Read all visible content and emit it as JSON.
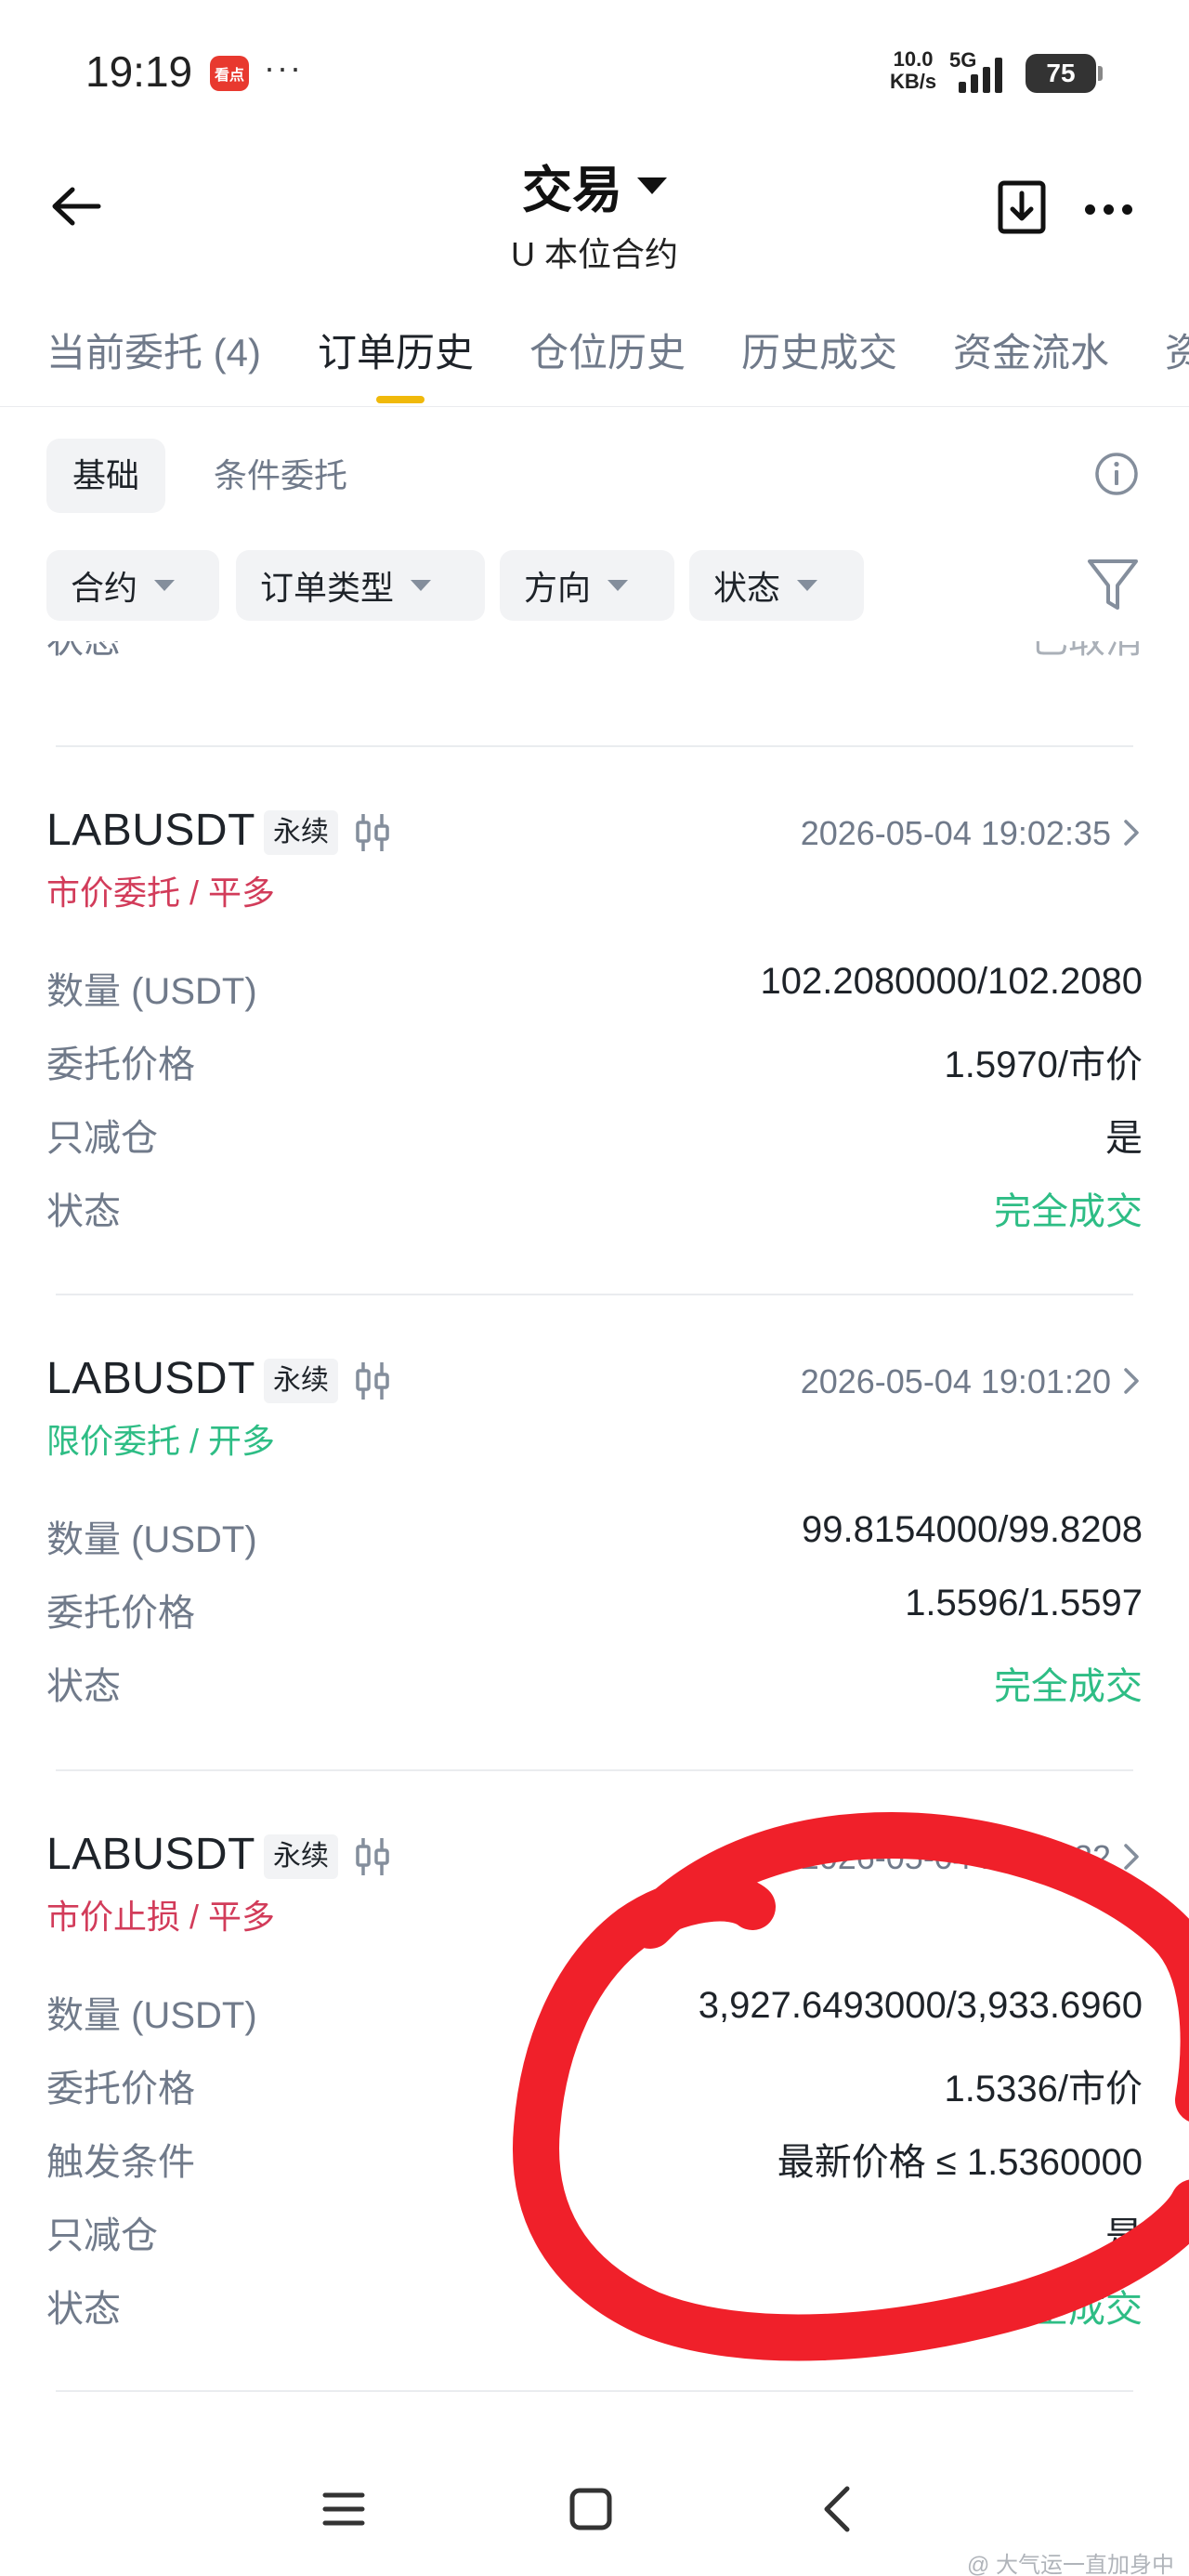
{
  "status_bar": {
    "time": "19:19",
    "app_icon_text": "看点",
    "dots": "···",
    "net_speed_value": "10.0",
    "net_speed_unit": "KB/s",
    "network_type": "5G",
    "battery": "75"
  },
  "header": {
    "title": "交易",
    "subtitle": "U 本位合约"
  },
  "tabs": [
    {
      "label": "当前委托 (4)"
    },
    {
      "label": "订单历史"
    },
    {
      "label": "仓位历史"
    },
    {
      "label": "历史成交"
    },
    {
      "label": "资金流水"
    },
    {
      "label": "资"
    }
  ],
  "subtabs": [
    {
      "label": "基础"
    },
    {
      "label": "条件委托"
    }
  ],
  "filters": [
    {
      "label": "合约"
    },
    {
      "label": "订单类型"
    },
    {
      "label": "方向"
    },
    {
      "label": "状态"
    }
  ],
  "partial_row": {
    "label": "状态",
    "value": "已取消"
  },
  "orders": [
    {
      "symbol": "LABUSDT",
      "badge": "永续",
      "time": "2026-05-04 19:02:35",
      "type": "市价委托 / 平多",
      "rows": [
        {
          "label": "数量 (USDT)",
          "value": "102.2080000/102.2080"
        },
        {
          "label": "委托价格",
          "value": "1.5970/市价"
        },
        {
          "label": "只减仓",
          "value": "是"
        },
        {
          "label": "状态",
          "value": "完全成交"
        }
      ]
    },
    {
      "symbol": "LABUSDT",
      "badge": "永续",
      "time": "2026-05-04 19:01:20",
      "type": "限价委托 / 开多",
      "rows": [
        {
          "label": "数量 (USDT)",
          "value": "99.8154000/99.8208"
        },
        {
          "label": "委托价格",
          "value": "1.5596/1.5597"
        },
        {
          "label": "状态",
          "value": "完全成交"
        }
      ]
    },
    {
      "symbol": "LABUSDT",
      "badge": "永续",
      "time": "2026-05-04 18:34:32",
      "type": "市价止损 / 平多",
      "rows": [
        {
          "label": "数量 (USDT)",
          "value": "3,927.6493000/3,933.6960"
        },
        {
          "label": "委托价格",
          "value": "1.5336/市价"
        },
        {
          "label": "触发条件",
          "value": "最新价格 ≤ 1.5360000"
        },
        {
          "label": "只减仓",
          "value": "是"
        },
        {
          "label": "状态",
          "value": "完全成交"
        }
      ]
    }
  ],
  "watermark": "@ 大气运一直加身中",
  "colors": {
    "accent": "#f0b90b",
    "sell": "#d23c5a",
    "buy": "#2ebd85",
    "scribble": "#f0202a"
  }
}
